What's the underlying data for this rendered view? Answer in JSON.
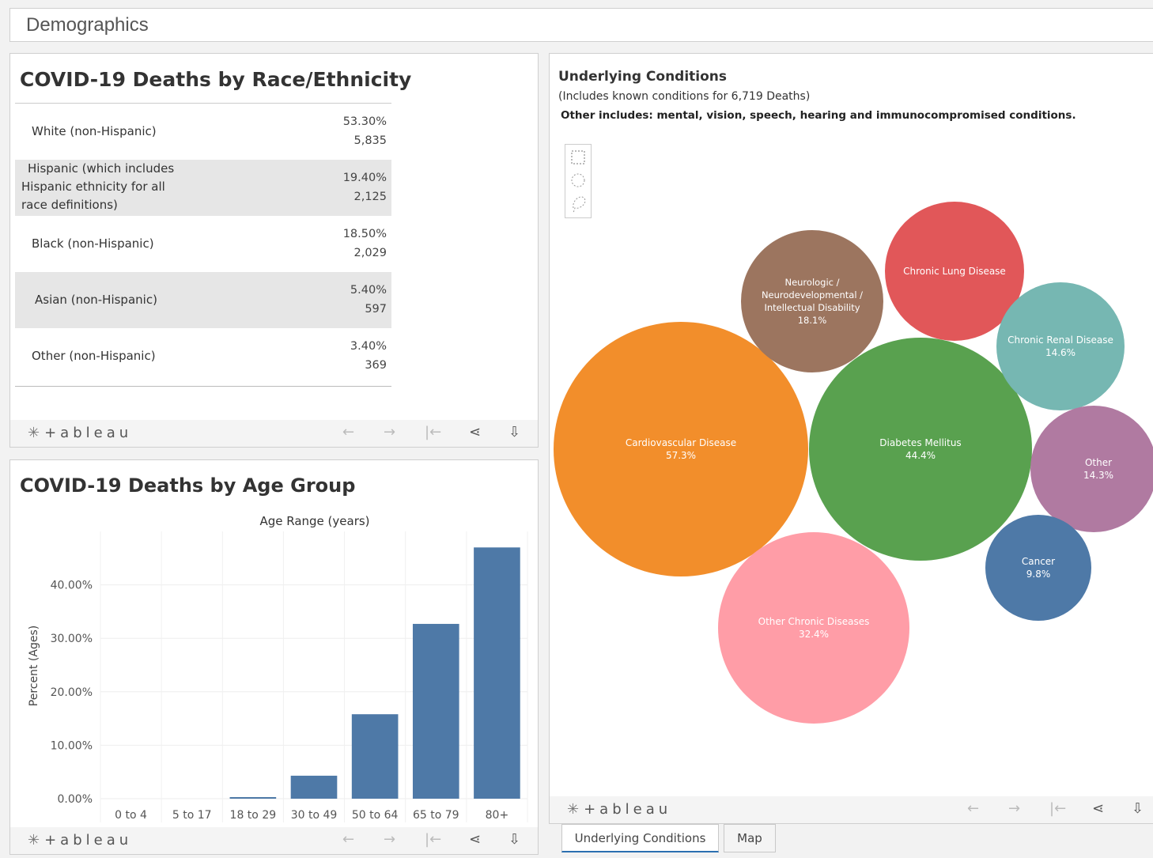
{
  "header": {
    "title": "Demographics"
  },
  "race_panel": {
    "title": "COVID-19 Deaths by Race/Ethnicity",
    "rows": [
      {
        "label_lines": [
          "White (non-Hispanic)"
        ],
        "pct": "53.30%",
        "count": "5,835",
        "shaded": false
      },
      {
        "label_lines": [
          "Hispanic (which includes",
          "Hispanic ethnicity for all",
          "race definitions)"
        ],
        "pct": "19.40%",
        "count": "2,125",
        "shaded": true
      },
      {
        "label_lines": [
          "Black (non-Hispanic)"
        ],
        "pct": "18.50%",
        "count": "2,029",
        "shaded": false
      },
      {
        "label_lines": [
          "Asian (non-Hispanic)"
        ],
        "pct": "5.40%",
        "count": "597",
        "shaded": true
      },
      {
        "label_lines": [
          "Other (non-Hispanic)"
        ],
        "pct": "3.40%",
        "count": "369",
        "shaded": false
      }
    ]
  },
  "age_panel": {
    "title": "COVID-19 Deaths by Age Group"
  },
  "conditions_panel": {
    "title": "Underlying Conditions",
    "subtitle": "(Includes known conditions for 6,719 Deaths)",
    "note": "Other includes: mental, vision, speech, hearing and immunocompromised conditions."
  },
  "toolbar": {
    "logo_text": "+ableau",
    "logo_star": "✳",
    "back_icon": "←",
    "forward_icon": "→",
    "reset_icon": "|←",
    "share_icon": "⋖",
    "download_icon": "⇩"
  },
  "tabs": [
    {
      "label": "Underlying Conditions",
      "active": true
    },
    {
      "label": "Map",
      "active": false
    }
  ],
  "chart_data": [
    {
      "type": "bar",
      "title": "Age Range (years)",
      "xlabel": "",
      "ylabel": "Percent (Ages)",
      "categories": [
        "0 to 4",
        "5 to 17",
        "18 to 29",
        "30 to 49",
        "50 to 64",
        "65 to 79",
        "80+"
      ],
      "values": [
        0.0,
        0.0,
        0.3,
        4.3,
        15.8,
        32.7,
        47.0
      ],
      "ylim": [
        0,
        50
      ],
      "yticks": [
        "0.00%",
        "10.00%",
        "20.00%",
        "30.00%",
        "40.00%"
      ],
      "bar_color": "#4e79a7",
      "grid": true
    },
    {
      "type": "bubble",
      "title": "Underlying Conditions",
      "bubbles": [
        {
          "name": "Cardiovascular Disease",
          "value": "57.3%",
          "color": "#f28e2b"
        },
        {
          "name": "Diabetes Mellitus",
          "value": "44.4%",
          "color": "#59a14f"
        },
        {
          "name": "Other Chronic Diseases",
          "value": "32.4%",
          "color": "#ff9da7"
        },
        {
          "name": "Neurologic / Neurodevelopmental / Intellectual  Disability",
          "label_lines": [
            "Neurologic /",
            "Neurodevelopmental /",
            "Intellectual  Disability"
          ],
          "value": "18.1%",
          "color": "#9c755f"
        },
        {
          "name": "Chronic Lung Disease",
          "value": "",
          "color": "#e15759"
        },
        {
          "name": "Chronic Renal Disease",
          "value": "14.6%",
          "color": "#76b7b2"
        },
        {
          "name": "Other",
          "value": "14.3%",
          "color": "#b07aa1"
        },
        {
          "name": "Cancer",
          "value": "9.8%",
          "color": "#4e79a7"
        }
      ]
    }
  ]
}
